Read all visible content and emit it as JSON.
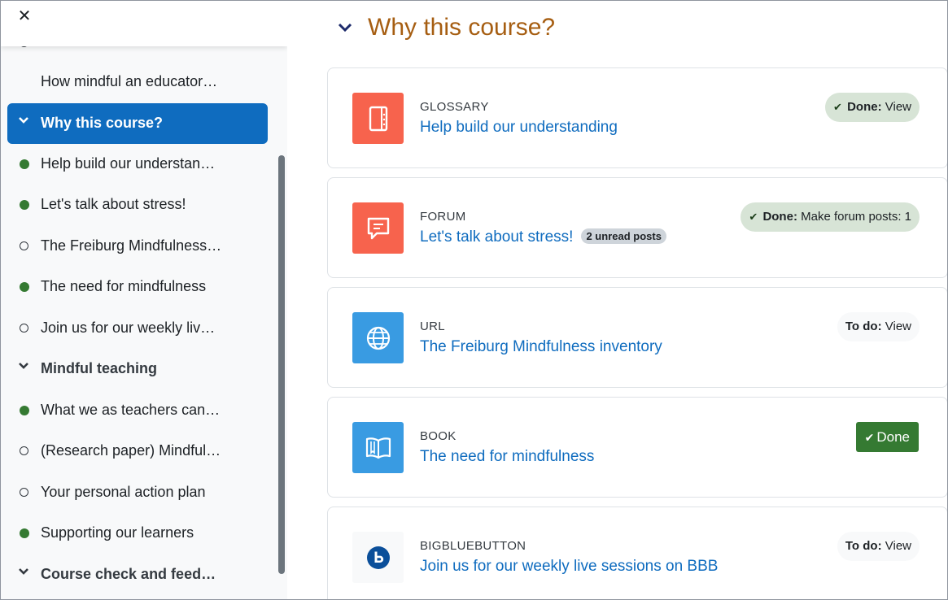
{
  "drawer": {
    "close_icon": "close-icon",
    "items": [
      {
        "label": "How mindful an educator…",
        "status": "none"
      },
      {
        "label": "Why this course?",
        "type": "section",
        "active": true
      },
      {
        "label": "Help build our understan…",
        "status": "done"
      },
      {
        "label": "Let's talk about stress!",
        "status": "done"
      },
      {
        "label": "The Freiburg Mindfulness…",
        "status": "todo"
      },
      {
        "label": "The need for mindfulness",
        "status": "done"
      },
      {
        "label": "Join us for our weekly liv…",
        "status": "todo"
      },
      {
        "label": "Mindful teaching",
        "type": "section"
      },
      {
        "label": "What we as teachers can…",
        "status": "done"
      },
      {
        "label": "(Research paper) Mindful…",
        "status": "todo"
      },
      {
        "label": "Your personal action plan",
        "status": "todo"
      },
      {
        "label": "Supporting our learners",
        "status": "done"
      },
      {
        "label": "Course check and feed…",
        "type": "section"
      }
    ]
  },
  "main": {
    "section_title": "Why this course?",
    "activities": [
      {
        "type": "GLOSSARY",
        "title": "Help build our understanding",
        "icon": "glossary-icon",
        "icon_color": "#f7634d",
        "completion": {
          "key": "Done:",
          "value": "View",
          "style": "done-light"
        }
      },
      {
        "type": "FORUM",
        "title": "Let's talk about stress!",
        "unread": "2 unread posts",
        "icon": "forum-icon",
        "icon_color": "#f7634d",
        "completion": {
          "key": "Done:",
          "value": "Make forum posts: 1",
          "style": "done-light"
        }
      },
      {
        "type": "URL",
        "title": "The Freiburg Mindfulness inventory",
        "icon": "globe-icon",
        "icon_color": "#399be2",
        "completion": {
          "key": "To do:",
          "value": "View",
          "style": "todo"
        }
      },
      {
        "type": "BOOK",
        "title": "The need for mindfulness",
        "icon": "book-icon",
        "icon_color": "#399be2",
        "completion": {
          "label": "Done",
          "style": "done-button"
        }
      },
      {
        "type": "BIGBLUEBUTTON",
        "title": "Join us for our weekly live sessions on BBB",
        "icon": "bigbluebutton-icon",
        "icon_color": "#f8f9fa",
        "completion": {
          "key": "To do:",
          "value": "View",
          "style": "todo"
        }
      }
    ]
  },
  "colors": {
    "accent": "#0f6cbf",
    "section_title": "#a65e12",
    "done_green": "#357a32",
    "done_light_bg": "#d7e4d6",
    "activity_orange": "#f7634d",
    "activity_blue": "#399be2"
  }
}
